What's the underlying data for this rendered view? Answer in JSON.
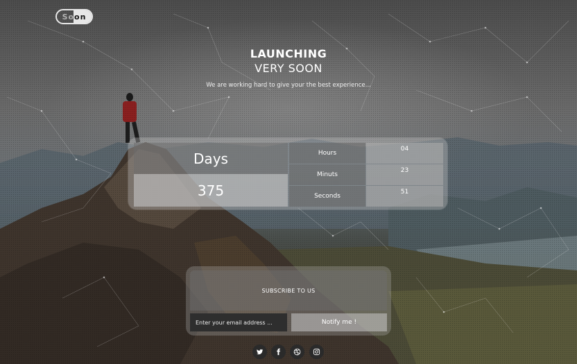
{
  "logo": {
    "text": "Soon"
  },
  "hero": {
    "title_line1": "LAUNCHING",
    "title_line2": "VERY SOON",
    "subtitle": "We are working hard to give your the best experience..."
  },
  "countdown": {
    "days_label": "Days",
    "days_value": "375",
    "rows": [
      {
        "label": "Hours",
        "value": "04"
      },
      {
        "label": "Minuts",
        "value": "23"
      },
      {
        "label": "Seconds",
        "value": "51"
      }
    ]
  },
  "subscribe": {
    "heading": "SUBSCRIBE TO US",
    "email_placeholder": "Enter your email address ...",
    "button_label": "Notify me !"
  },
  "social": [
    {
      "icon": "twitter-icon"
    },
    {
      "icon": "facebook-icon"
    },
    {
      "icon": "dribbble-icon"
    },
    {
      "icon": "instagram-icon"
    }
  ]
}
